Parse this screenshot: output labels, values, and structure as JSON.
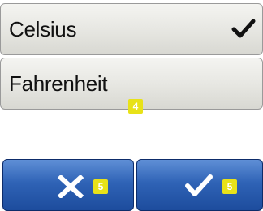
{
  "options": [
    {
      "label": "Celsius",
      "selected": true,
      "check_icon": "checkmark-icon"
    },
    {
      "label": "Fahrenheit",
      "selected": false
    }
  ],
  "list_step_badge": "4",
  "buttons": {
    "cancel": {
      "icon": "x-icon",
      "step_badge": "5"
    },
    "confirm": {
      "icon": "checkmark-icon",
      "step_badge": "5"
    }
  },
  "colors": {
    "option_background": "#e6e6e1",
    "button_blue": "#2f63b6",
    "badge_yellow": "#e8e218"
  }
}
